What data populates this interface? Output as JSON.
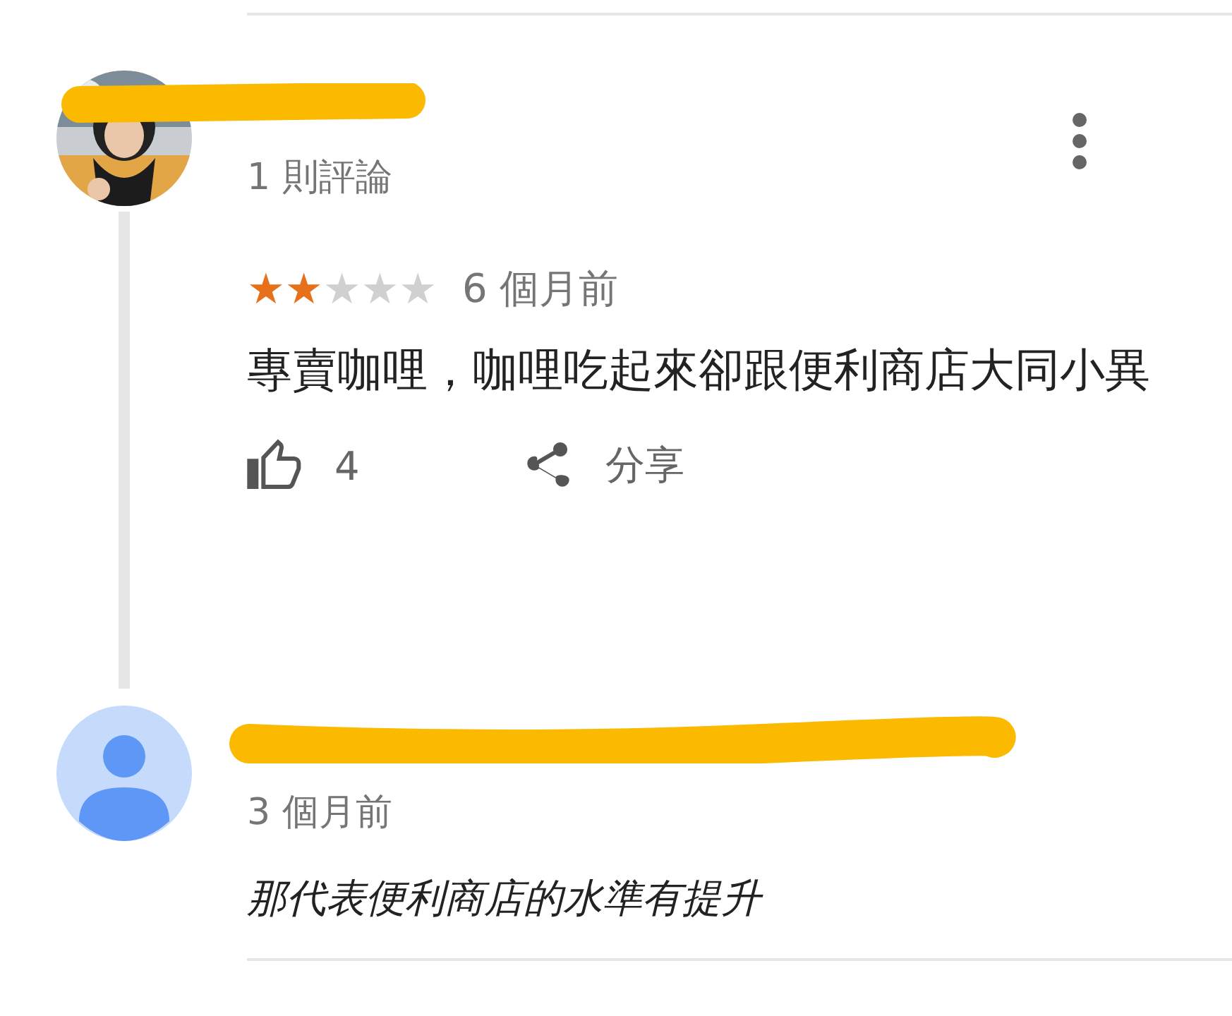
{
  "review": {
    "review_count": "1 則評論",
    "stars": 2,
    "time": "6 個月前",
    "text": "專賣咖哩，咖哩吃起來卻跟便利商店大同小異",
    "likes": "4",
    "share": "分享"
  },
  "reply": {
    "avatar": {
      "kind": "default"
    },
    "time": "3 個月前",
    "text": "那代表便利商店的水準有提升"
  }
}
